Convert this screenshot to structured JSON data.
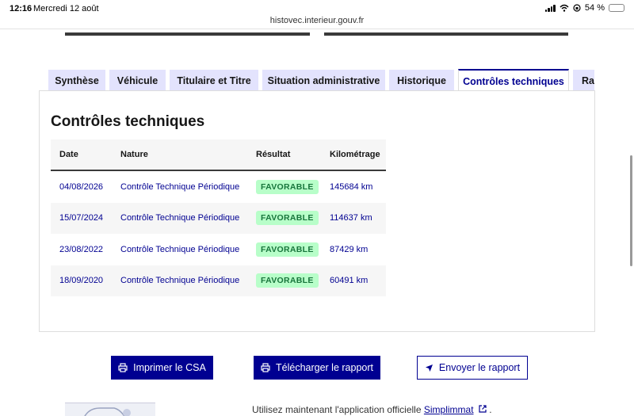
{
  "status_bar": {
    "time": "12:16",
    "date": "Mercredi 12 août",
    "battery": "54 %"
  },
  "browser": {
    "url": "histovec.interieur.gouv.fr"
  },
  "tabs": [
    {
      "label": "Synthèse",
      "active": false
    },
    {
      "label": "Véhicule",
      "active": false
    },
    {
      "label": "Titulaire et Titre",
      "active": false
    },
    {
      "label": "Situation administrative",
      "active": false
    },
    {
      "label": "Historique",
      "active": false
    },
    {
      "label": "Contrôles techniques",
      "active": true
    },
    {
      "label": "Rap",
      "active": false
    }
  ],
  "panel": {
    "title": "Contrôles techniques",
    "table": {
      "headers": [
        "Date",
        "Nature",
        "Résultat",
        "Kilométrage"
      ],
      "rows": [
        {
          "date": "04/08/2026",
          "nature": "Contrôle Technique Périodique",
          "result": "FAVORABLE",
          "km": "145684 km"
        },
        {
          "date": "15/07/2024",
          "nature": "Contrôle Technique Périodique",
          "result": "FAVORABLE",
          "km": "114637 km"
        },
        {
          "date": "23/08/2022",
          "nature": "Contrôle Technique Périodique",
          "result": "FAVORABLE",
          "km": "87429 km"
        },
        {
          "date": "18/09/2020",
          "nature": "Contrôle Technique Périodique",
          "result": "FAVORABLE",
          "km": "60491 km"
        }
      ]
    }
  },
  "actions": {
    "print_csa": "Imprimer le CSA",
    "download_report": "Télécharger le rapport",
    "send_report": "Envoyer le rapport"
  },
  "footer": {
    "text": "Utilisez maintenant l'application officielle",
    "link": "Simplimmat",
    "suffix": "."
  },
  "colors": {
    "primary": "#000091",
    "tab_bg": "#e3e3fd",
    "badge_bg": "#b8fec9",
    "badge_text": "#18753c"
  }
}
